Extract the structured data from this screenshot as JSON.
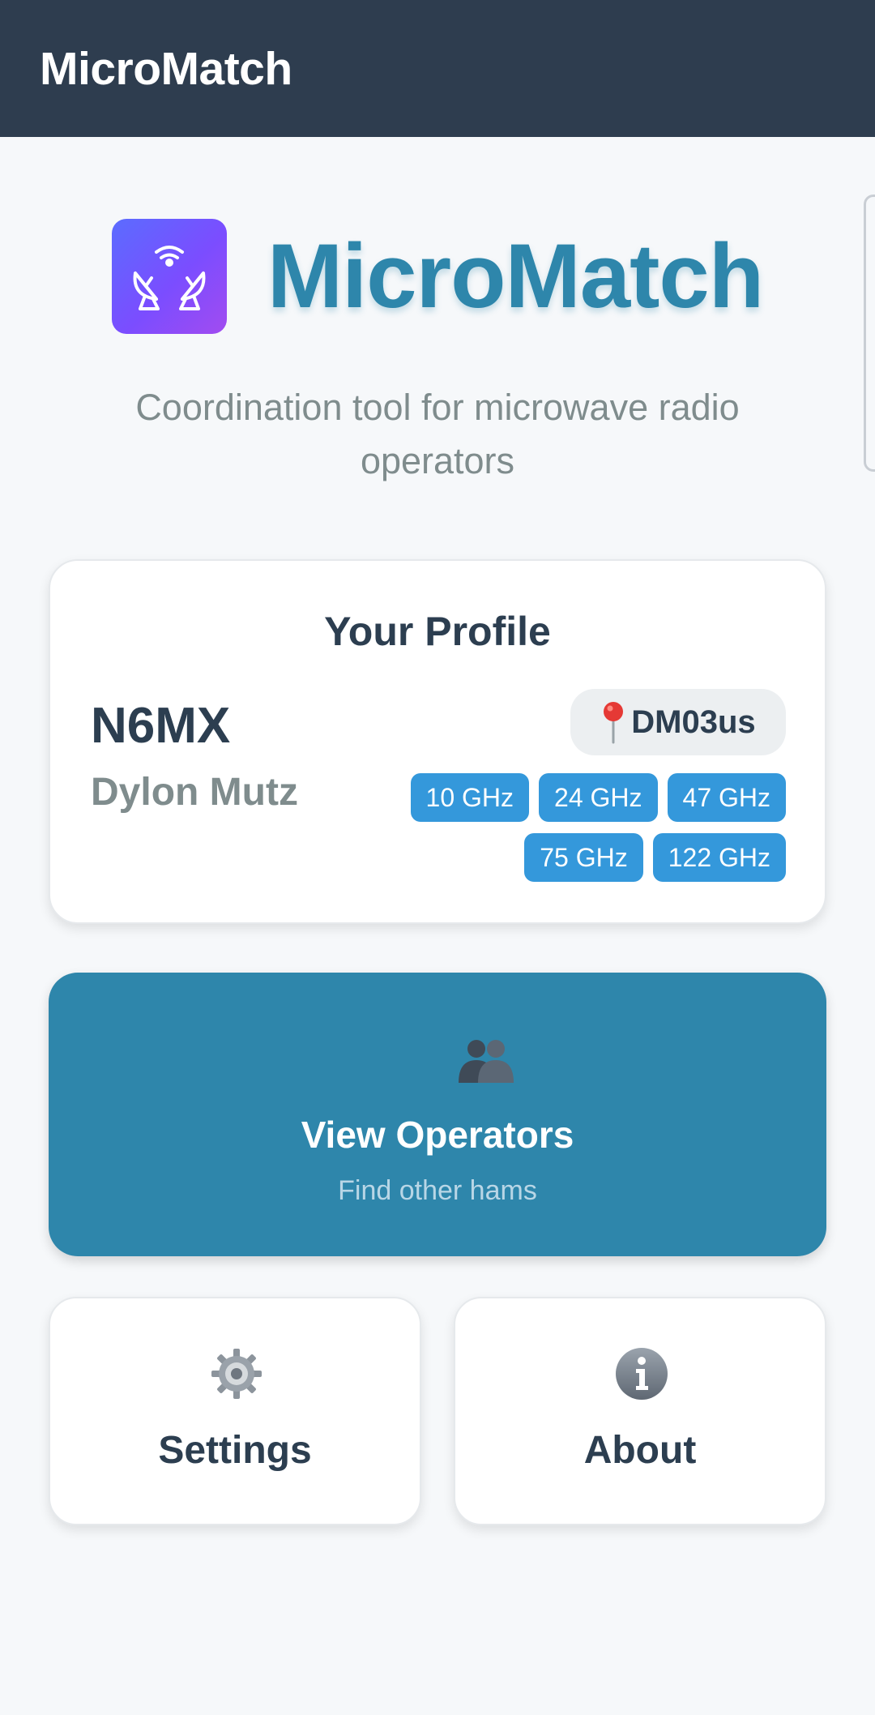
{
  "appbar": {
    "title": "MicroMatch"
  },
  "hero": {
    "brand": "MicroMatch",
    "tagline": "Coordination tool for microwave radio operators"
  },
  "profile": {
    "heading": "Your Profile",
    "callsign": "N6MX",
    "name": "Dylon Mutz",
    "grid": "DM03us",
    "bands": [
      "10 GHz",
      "24 GHz",
      "47 GHz",
      "75 GHz",
      "122 GHz"
    ]
  },
  "operators": {
    "title": "View Operators",
    "subtitle": "Find other hams"
  },
  "tiles": {
    "settings": "Settings",
    "about": "About"
  },
  "icons": {
    "logo": "satellite-dish-icon",
    "grid": "pin-icon",
    "operators": "people-icon",
    "settings": "gear-icon",
    "about": "info-icon"
  },
  "colors": {
    "appbar": "#2e3d4f",
    "brand": "#2e86ab",
    "band_chip": "#3498db",
    "operators_button": "#2e86ab"
  }
}
